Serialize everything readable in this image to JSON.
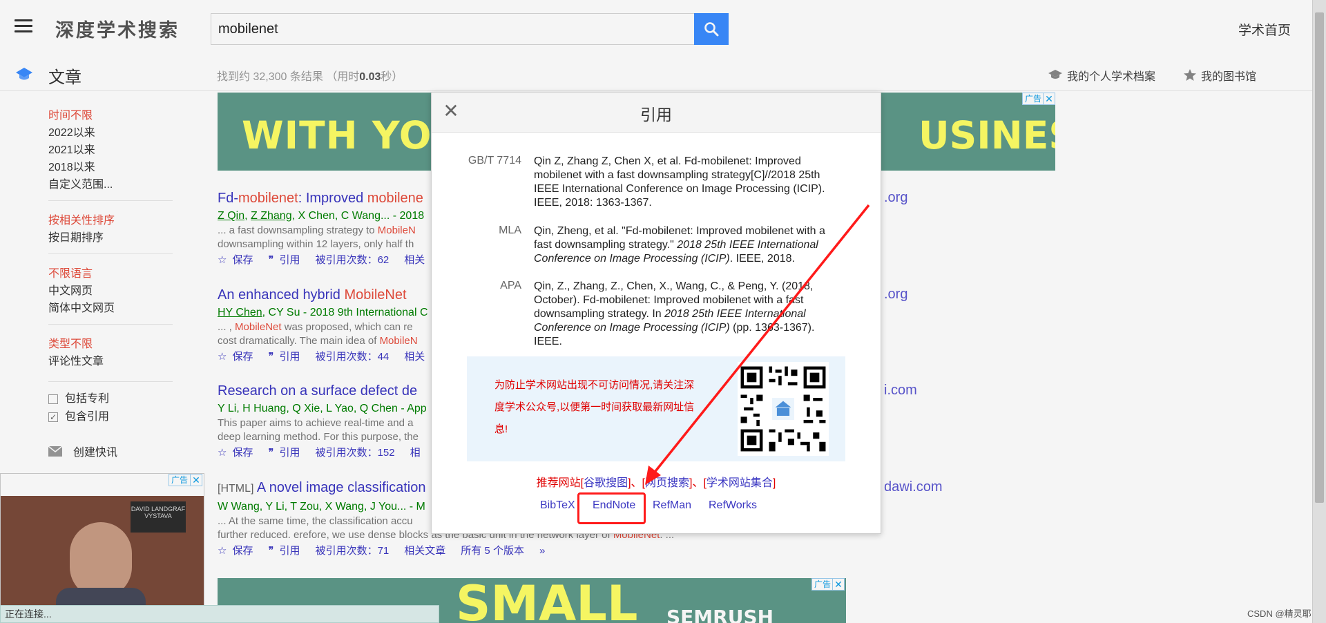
{
  "header": {
    "logo": "深度学术搜索",
    "search_value": "mobilenet",
    "home_link": "学术首页"
  },
  "subhead": {
    "title": "文章",
    "result_prefix": "找到约 32,300 条结果 （用时",
    "result_time": "0.03",
    "result_suffix": "秒）",
    "profile_link": "我的个人学术档案",
    "library_link": "我的图书馆"
  },
  "sidebar": {
    "time": [
      "时间不限",
      "2022以来",
      "2021以来",
      "2018以来",
      "自定义范围..."
    ],
    "sort": [
      "按相关性排序",
      "按日期排序"
    ],
    "lang": [
      "不限语言",
      "中文网页",
      "简体中文网页"
    ],
    "type": [
      "类型不限",
      "评论性文章"
    ],
    "include_patent": "包括专利",
    "include_citation": "包含引用",
    "create_alert": "创建快讯"
  },
  "ads": {
    "tag": "广告",
    "close": "✕",
    "banner_left": "WITH YOUR",
    "banner_right": "USINESS",
    "bottom_text": "SMALL",
    "bottom_brand": "SEMRUSH",
    "left_sign": "DAVID LANDGRAF VÝSTAVA"
  },
  "results": [
    {
      "title_a": "Fd-",
      "title_b": "mobilenet",
      "title_c": ": Improved ",
      "title_d": "mobilene",
      "authors_a": "Z Qin",
      "authors_b": "Z Zhang",
      "authors_c": ", X Chen, C Wang... - 2018",
      "abs1_a": "... a fast downsampling strategy to ",
      "abs1_b": "MobileN",
      "abs2": "downsampling within 12 layers, only half th",
      "save": "保存",
      "cite": "引用",
      "cited": "被引用次数：62",
      "related": "相关",
      "right_url": ".org"
    },
    {
      "title_a": "An enhanced hybrid ",
      "title_b": "MobileNet",
      "authors_a": "HY Chen",
      "authors_c": ", CY Su - 2018 9th International C",
      "abs1_a": "... , ",
      "abs1_b": "MobileNet",
      "abs1_c": " was proposed, which can re",
      "abs2_a": "cost dramatically. The main idea of ",
      "abs2_b": "MobileN",
      "save": "保存",
      "cite": "引用",
      "cited": "被引用次数：44",
      "related": "相关",
      "right_url": ".org"
    },
    {
      "title_a": "Research on a surface defect de",
      "authors_c": "Y Li, H Huang, Q Xie, L Yao, Q Chen - App",
      "abs1_a": "This paper aims to achieve real-time and a",
      "abs2": "deep learning method. For this purpose, the",
      "save": "保存",
      "cite": "引用",
      "cited": "被引用次数：152",
      "related": "相",
      "right_url": "i.com"
    },
    {
      "html_tag": "[HTML]",
      "title_a": " A novel image classification",
      "authors_c": "W Wang, Y Li, T Zou, X Wang, J You... - M",
      "abs1_a": "... At the same time, the classification accu",
      "abs2_a": "further reduced. erefore, we use dense blocks as the basic unit in the network layer of ",
      "abs2_b": "MobileNet",
      "abs2_c": ". ...",
      "save": "保存",
      "cite": "引用",
      "cited": "被引用次数：71",
      "related": "相关文章",
      "versions": "所有 5 个版本",
      "right_url": "dawi.com"
    }
  ],
  "modal": {
    "title": "引用",
    "close": "✕",
    "gbt_label": "GB/T 7714",
    "gbt_text": "Qin Z, Zhang Z, Chen X, et al. Fd-mobilenet: Improved mobilenet with a fast downsampling strategy[C]//2018 25th IEEE International Conference on Image Processing (ICIP). IEEE, 2018: 1363-1367.",
    "mla_label": "MLA",
    "mla_a": "Qin, Zheng, et al. \"Fd-mobilenet: Improved mobilenet with a fast downsampling strategy.\" ",
    "mla_i": "2018 25th IEEE International Conference on Image Processing (ICIP)",
    "mla_b": ". IEEE, 2018.",
    "apa_label": "APA",
    "apa_a": "Qin, Z., Zhang, Z., Chen, X., Wang, C., & Peng, Y. (2018, October). Fd-mobilenet: Improved mobilenet with a fast downsampling strategy. In ",
    "apa_i": "2018 25th IEEE International Conference on Image Processing (ICIP)",
    "apa_b": " (pp. 1363-1367). IEEE.",
    "notice": "为防止学术网站出现不可访问情况,请关注深度学术公众号,以便第一时间获取最新网址信息!",
    "rec_prefix": "推荐网站[",
    "rec_link1": "谷歌搜图",
    "rec_mid1": "]、[",
    "rec_link2": "网页搜索",
    "rec_mid2": "]、[",
    "rec_link3": "学术网站集合",
    "rec_suffix": "]",
    "export_bibtex": "BibTeX",
    "export_endnote": "EndNote",
    "export_refman": "RefMan",
    "export_refworks": "RefWorks"
  },
  "status": {
    "connecting": "正在连接...",
    "watermark": "CSDN @精灵耶"
  },
  "colors": {
    "accent_blue": "#3b8cff",
    "link": "#3b37c2",
    "highlight_red": "#e74c3c",
    "ad_green": "#5e9a8a",
    "ad_yellow": "#ffff66",
    "annotation_red": "#ff1a1a"
  }
}
